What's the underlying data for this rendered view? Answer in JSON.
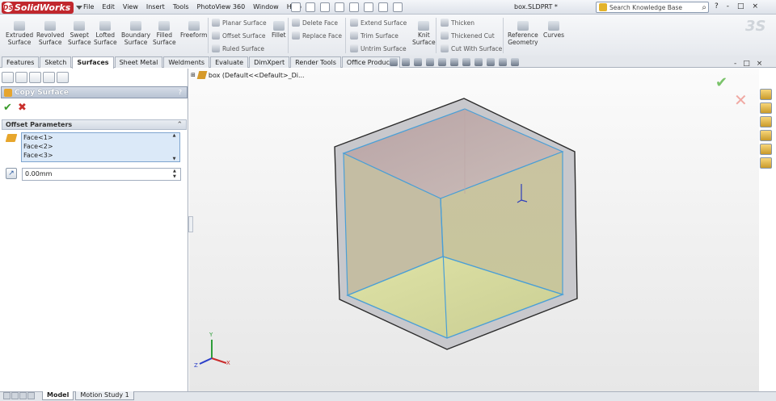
{
  "app": {
    "name": "SolidWorks",
    "doc_title": "box.SLDPRT *"
  },
  "menu": [
    "File",
    "Edit",
    "View",
    "Insert",
    "Tools",
    "PhotoView 360",
    "Window",
    "Help"
  ],
  "search": {
    "placeholder": "Search Knowledge Base"
  },
  "window_controls": [
    "?",
    "-",
    "□",
    "×"
  ],
  "toolbar": {
    "big": [
      {
        "l1": "Extruded",
        "l2": "Surface"
      },
      {
        "l1": "Revolved",
        "l2": "Surface"
      },
      {
        "l1": "Swept",
        "l2": "Surface"
      },
      {
        "l1": "Lofted",
        "l2": "Surface"
      },
      {
        "l1": "Boundary",
        "l2": "Surface"
      },
      {
        "l1": "Filled",
        "l2": "Surface"
      },
      {
        "l1": "Freeform",
        "l2": ""
      }
    ],
    "col1": [
      "Planar Surface",
      "Offset Surface",
      "Ruled Surface"
    ],
    "fillet": "Fillet",
    "col2": [
      "Delete Face",
      "Replace Face"
    ],
    "col3": [
      "Extend Surface",
      "Trim Surface",
      "Untrim Surface"
    ],
    "knit": {
      "l1": "Knit",
      "l2": "Surface"
    },
    "col4": [
      "Thicken",
      "Thickened Cut",
      "Cut With Surface"
    ],
    "refgeo": {
      "l1": "Reference",
      "l2": "Geometry"
    },
    "curves": "Curves"
  },
  "tabs": [
    "Features",
    "Sketch",
    "Surfaces",
    "Sheet Metal",
    "Weldments",
    "Evaluate",
    "DimXpert",
    "Render Tools",
    "Office Products"
  ],
  "active_tab": "Surfaces",
  "view_controls": [
    "-",
    "□",
    "×"
  ],
  "property_manager": {
    "title": "Copy Surface",
    "help": "?",
    "group": "Offset Parameters",
    "faces": [
      "Face<1>",
      "Face<2>",
      "Face<3>"
    ],
    "offset_value": "0.00mm"
  },
  "feature_tree": {
    "label": "box  (Default<<Default>_Di..."
  },
  "triad_labels": {
    "x": "X",
    "y": "Y",
    "z": "Z"
  },
  "bottom_tabs": [
    "Model",
    "Motion Study 1"
  ],
  "colors": {
    "accent": "#3a9b2a",
    "selection": "#4a9fd6",
    "cube_yellow": "#d8dda0",
    "cube_pink": "#b9a3a3"
  }
}
